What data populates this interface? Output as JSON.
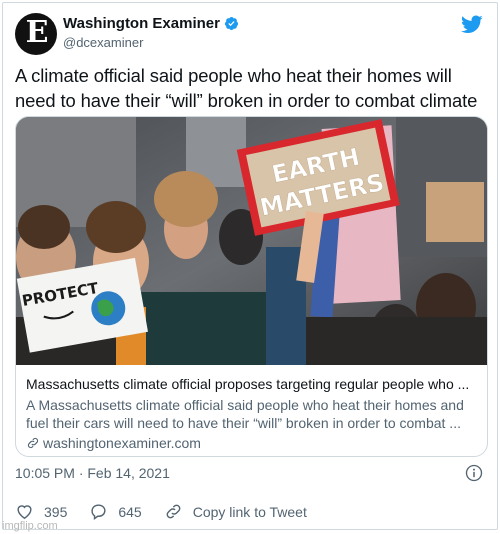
{
  "account": {
    "name": "Washington Examiner",
    "handle": "@dcexaminer",
    "avatar_letter": "E"
  },
  "tweet": {
    "text": "A climate official said people who heat their homes will need to have their “will” broken in order to combat climate change."
  },
  "link_card": {
    "title": "Massachusetts climate official proposes targeting regular people who ...",
    "description_line1": "A Massachusetts climate official said people who heat their homes and",
    "description_line2": "fuel their cars will need to have their “will” broken in order to combat ...",
    "domain": "washingtonexaminer.com",
    "image_signs": {
      "earth_line1": "EARTH",
      "earth_line2": "MATTERS",
      "protect": "PROTECT"
    }
  },
  "meta": {
    "timestamp": "10:05 PM · Feb 14, 2021"
  },
  "actions": {
    "likes": "395",
    "replies": "645",
    "copy_link": "Copy link to Tweet"
  },
  "watermark": "imgflip.com",
  "colors": {
    "twitter_blue": "#1d9bf0",
    "text_primary": "#0f1419",
    "text_secondary": "#536471",
    "border": "#cfd9de"
  },
  "icons": [
    "verified-badge-icon",
    "twitter-bird-icon",
    "link-icon",
    "info-icon",
    "heart-icon",
    "reply-icon",
    "copy-link-icon"
  ]
}
